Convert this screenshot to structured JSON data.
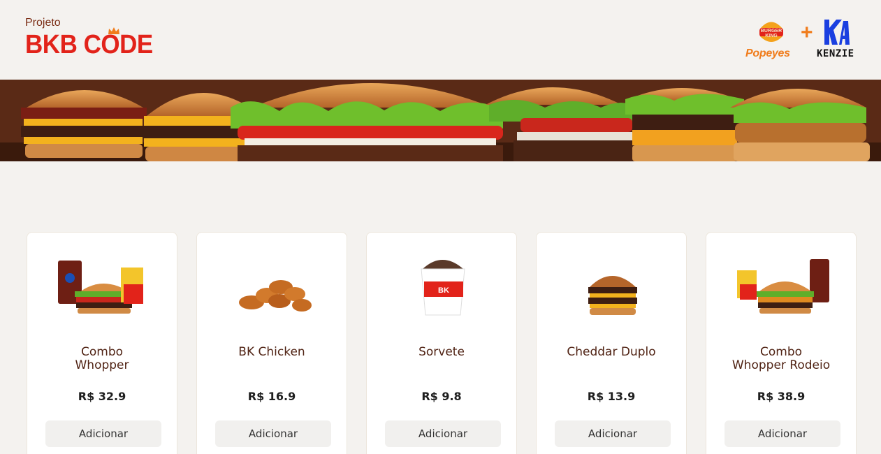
{
  "header": {
    "brand_prefix": "Projeto",
    "brand_name": "BKB CODE",
    "partner_logos": [
      "burger-king-logo",
      "popeyes-logo",
      "kenzie-logo"
    ],
    "bk_logo_text_1": "BURGER",
    "bk_logo_text_2": "KING",
    "popeyes_text": "Popeyes",
    "plus_sign": "+",
    "kenzie_text": "KENZIE"
  },
  "banner": {
    "image": "burgers-banner"
  },
  "colors": {
    "brand_red": "#e2231a",
    "brand_brown": "#502314",
    "popeyes_orange": "#f07c1b",
    "kenzie_blue": "#1a3fe0"
  },
  "products": [
    {
      "name": "Combo\nWhopper",
      "price": "R$ 32.9",
      "button": "Adicionar",
      "image": "combo-whopper-image"
    },
    {
      "name": "BK Chicken",
      "price": "R$ 16.9",
      "button": "Adicionar",
      "image": "bk-chicken-image"
    },
    {
      "name": "Sorvete",
      "price": "R$ 9.8",
      "button": "Adicionar",
      "image": "sorvete-image"
    },
    {
      "name": "Cheddar Duplo",
      "price": "R$ 13.9",
      "button": "Adicionar",
      "image": "cheddar-duplo-image"
    },
    {
      "name": "Combo\nWhopper Rodeio",
      "price": "R$ 38.9",
      "button": "Adicionar",
      "image": "combo-whopper-rodeio-image"
    }
  ]
}
